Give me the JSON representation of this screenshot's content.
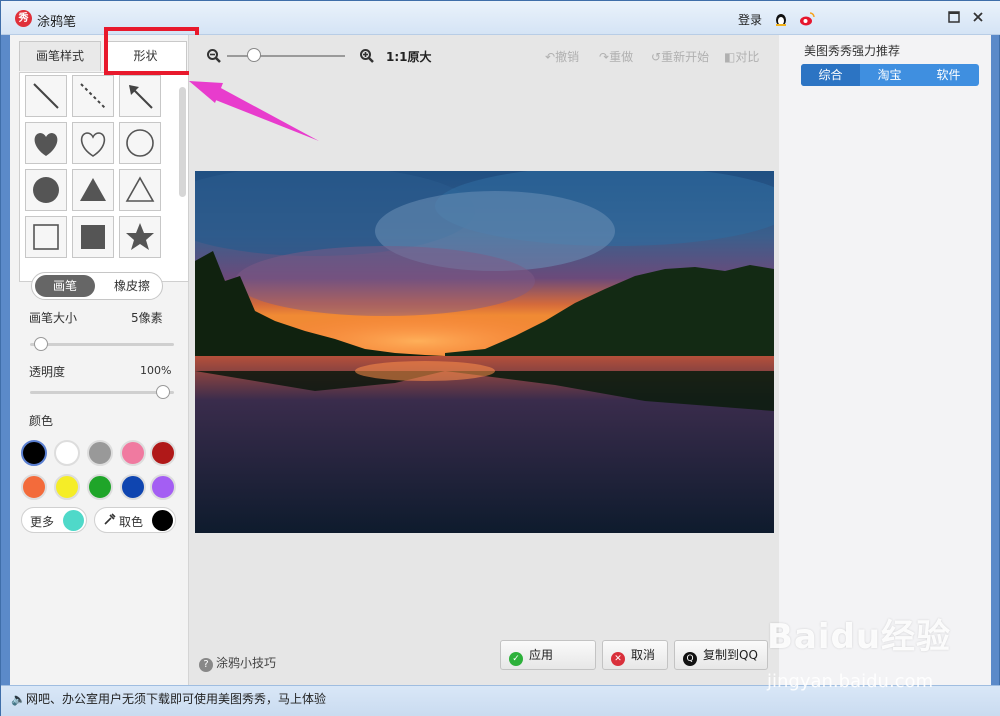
{
  "window": {
    "title": "涂鸦笔",
    "login": "登录",
    "logo_text": "秀"
  },
  "left": {
    "tabs": [
      {
        "label": "画笔样式"
      },
      {
        "label": "形状"
      }
    ],
    "modes": {
      "brush": "画笔",
      "eraser": "橡皮擦"
    },
    "brush_size": {
      "label": "画笔大小",
      "value": "5像素"
    },
    "opacity": {
      "label": "透明度",
      "value": "100%"
    },
    "colors_label": "颜色",
    "colors": [
      "#000000",
      "#ffffff",
      "#999999",
      "#f07aa0",
      "#b01818",
      "#f36b3b",
      "#f5ed27",
      "#1fa529",
      "#0f45b0",
      "#a45ef3"
    ],
    "more_label": "更多",
    "more_color": "#4fd9c9",
    "pick_label": "取色",
    "pick_color": "#000000"
  },
  "canvas": {
    "zoom_label": "1:1原大",
    "undo": "撤销",
    "redo": "重做",
    "restart": "重新开始",
    "compare": "对比",
    "tips": "涂鸦小技巧",
    "apply": "应用",
    "cancel": "取消",
    "copy_qq": "复制到QQ"
  },
  "right": {
    "title": "美图秀秀强力推荐",
    "tabs": [
      "综合",
      "淘宝",
      "软件"
    ]
  },
  "status": {
    "text": "网吧、办公室用户无须下载即可使用美图秀秀，马上体验"
  },
  "watermark": {
    "main": "Baidu经验",
    "sub": "jingyan.baidu.com"
  }
}
